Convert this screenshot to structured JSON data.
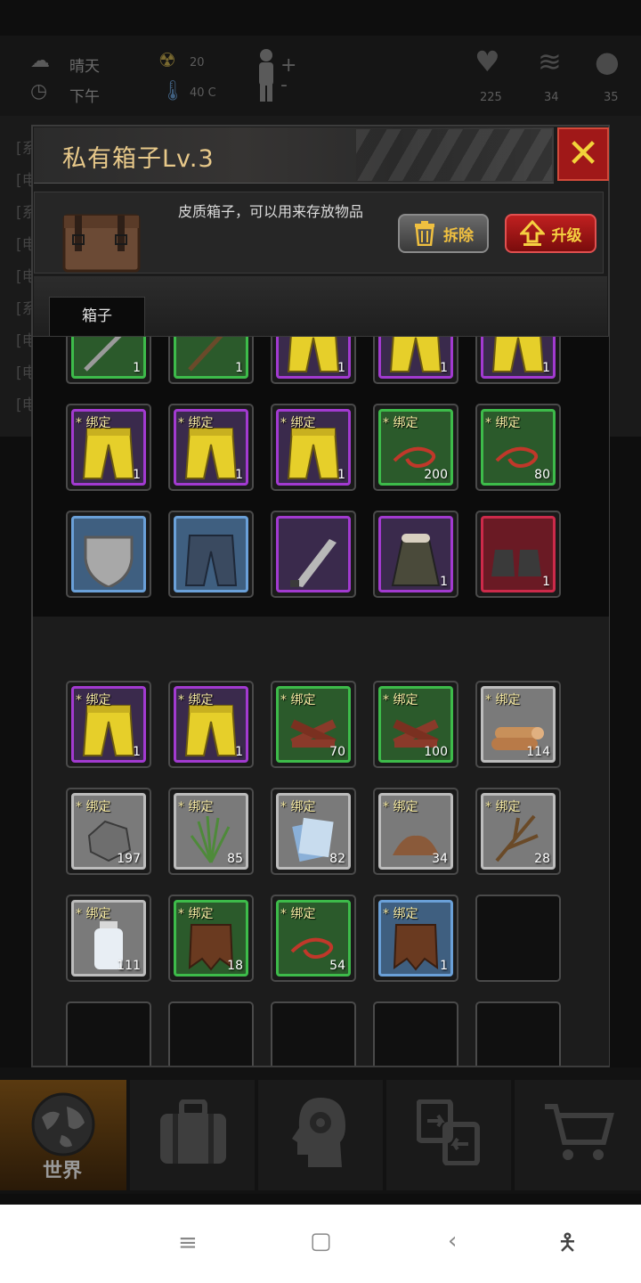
{
  "status": {
    "weather": "晴天",
    "time": "下午",
    "radiation": "20",
    "temperature": "40 C",
    "health": "225",
    "stomach": "34",
    "mind": "35"
  },
  "log_lines": [
    "[系",
    "[电",
    "[系",
    "[电",
    "[电",
    "[系",
    "[电",
    "[电",
    "[电"
  ],
  "dialog": {
    "title": "私有箱子Lv.3",
    "description": "皮质箱子，可以用来存放物品",
    "dismantle_label": "拆除",
    "upgrade_label": "升级",
    "tab_label": "箱子",
    "bind_text": "* 绑定"
  },
  "upper_slots": [
    {
      "rarity": "green",
      "icon": "knife-icon",
      "count": "1",
      "bound": false
    },
    {
      "rarity": "green",
      "icon": "stick-icon",
      "count": "1",
      "bound": false
    },
    {
      "rarity": "purple",
      "icon": "pants-icon",
      "count": "1",
      "bound": false
    },
    {
      "rarity": "purple",
      "icon": "pants-icon",
      "count": "1",
      "bound": false
    },
    {
      "rarity": "purple",
      "icon": "pants-icon",
      "count": "1",
      "bound": false
    },
    {
      "rarity": "purple",
      "icon": "pants-icon",
      "count": "1",
      "bound": true
    },
    {
      "rarity": "purple",
      "icon": "pants-icon",
      "count": "1",
      "bound": true
    },
    {
      "rarity": "purple",
      "icon": "pants-icon",
      "count": "1",
      "bound": true
    },
    {
      "rarity": "green",
      "icon": "rope-icon",
      "count": "200",
      "bound": true
    },
    {
      "rarity": "green",
      "icon": "rope-icon",
      "count": "80",
      "bound": true
    },
    {
      "rarity": "blue",
      "icon": "shield-icon",
      "count": "",
      "bound": false
    },
    {
      "rarity": "blue",
      "icon": "jeans-icon",
      "count": "",
      "bound": false
    },
    {
      "rarity": "purple",
      "icon": "machete-icon",
      "count": "",
      "bound": false
    },
    {
      "rarity": "purple",
      "icon": "coat-icon",
      "count": "1",
      "bound": false
    },
    {
      "rarity": "red",
      "icon": "boots-icon",
      "count": "1",
      "bound": false
    }
  ],
  "lower_slots": [
    {
      "rarity": "purple",
      "icon": "pants-icon",
      "count": "1",
      "bound": true
    },
    {
      "rarity": "purple",
      "icon": "pants-icon",
      "count": "1",
      "bound": true
    },
    {
      "rarity": "green",
      "icon": "wood-pile-icon",
      "count": "70",
      "bound": true
    },
    {
      "rarity": "green",
      "icon": "wood-pile-icon",
      "count": "100",
      "bound": true
    },
    {
      "rarity": "grey",
      "icon": "logs-icon",
      "count": "114",
      "bound": true
    },
    {
      "rarity": "grey",
      "icon": "stone-icon",
      "count": "197",
      "bound": true
    },
    {
      "rarity": "grey",
      "icon": "grass-icon",
      "count": "85",
      "bound": true
    },
    {
      "rarity": "grey",
      "icon": "cloth-icon",
      "count": "82",
      "bound": true
    },
    {
      "rarity": "grey",
      "icon": "dirt-icon",
      "count": "34",
      "bound": true
    },
    {
      "rarity": "grey",
      "icon": "branches-icon",
      "count": "28",
      "bound": true
    },
    {
      "rarity": "grey",
      "icon": "bottle-icon",
      "count": "111",
      "bound": true
    },
    {
      "rarity": "green",
      "icon": "leather-icon",
      "count": "18",
      "bound": true
    },
    {
      "rarity": "green",
      "icon": "rope-icon",
      "count": "54",
      "bound": true
    },
    {
      "rarity": "blue",
      "icon": "leather-icon",
      "count": "1",
      "bound": true
    },
    {
      "rarity": "empty",
      "icon": "",
      "count": "",
      "bound": false
    },
    {
      "rarity": "empty",
      "icon": "",
      "count": "",
      "bound": false
    },
    {
      "rarity": "empty",
      "icon": "",
      "count": "",
      "bound": false
    },
    {
      "rarity": "empty",
      "icon": "",
      "count": "",
      "bound": false
    },
    {
      "rarity": "empty",
      "icon": "",
      "count": "",
      "bound": false
    },
    {
      "rarity": "empty",
      "icon": "",
      "count": "",
      "bound": false
    }
  ],
  "nav": {
    "world_label": "世界",
    "items": [
      "globe-icon",
      "backpack-icon",
      "head-gear-icon",
      "transfer-icon",
      "cart-icon"
    ]
  },
  "colors": {
    "title": "#e8c98a",
    "close_bg": "#a01818",
    "bind_text": "#f3e7a0"
  }
}
